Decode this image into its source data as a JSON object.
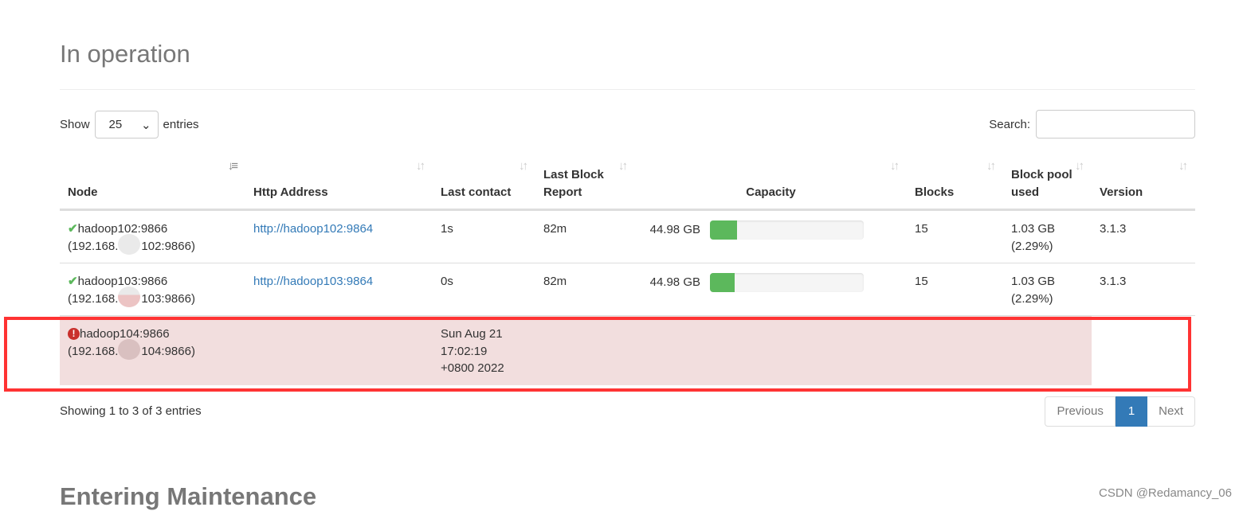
{
  "section_title": "In operation",
  "next_section_title": "Entering Maintenance",
  "length": {
    "show_label": "Show",
    "value": "25",
    "entries_label": "entries"
  },
  "search": {
    "label": "Search:",
    "value": ""
  },
  "columns": [
    "Node",
    "Http Address",
    "Last contact",
    "Last Block Report",
    "Capacity",
    "Blocks",
    "Block pool used",
    "Version"
  ],
  "sorted_column": "Node",
  "rows": [
    {
      "status": "alive",
      "status_icon": "check-icon",
      "node": "hadoop102:9866",
      "ip": "(192.168.",
      "ip_tail": "102:9866)",
      "http": "http://hadoop102:9864",
      "last_contact": "1s",
      "last_block_report": "82m",
      "capacity": "44.98 GB",
      "capacity_used_pct": 17.7,
      "blocks": "15",
      "bp_used": "1.03 GB",
      "bp_pct": "(2.29%)",
      "version": "3.1.3"
    },
    {
      "status": "alive",
      "status_icon": "check-icon",
      "node": "hadoop103:9866",
      "ip": "(192.168.",
      "ip_tail": "103:9866)",
      "http": "http://hadoop103:9864",
      "last_contact": "0s",
      "last_block_report": "82m",
      "capacity": "44.98 GB",
      "capacity_used_pct": 16.1,
      "blocks": "15",
      "bp_used": "1.03 GB",
      "bp_pct": "(2.29%)",
      "version": "3.1.3"
    },
    {
      "status": "dead",
      "status_icon": "exclamation-icon",
      "node": "hadoop104:9866",
      "ip": "(192.168.",
      "ip_tail": "104:9866)",
      "last_contact_lines": [
        "Sun Aug 21",
        "17:02:19",
        "+0800 2022"
      ]
    }
  ],
  "info": "Showing 1 to 3 of 3 entries",
  "pagination": {
    "previous": "Previous",
    "current": "1",
    "next": "Next"
  },
  "watermark": "CSDN @Redamancy_06",
  "colors": {
    "success": "#5cb85c",
    "danger_row": "#f2dede",
    "link": "#337ab7",
    "highlight_box": "#ff3333"
  }
}
